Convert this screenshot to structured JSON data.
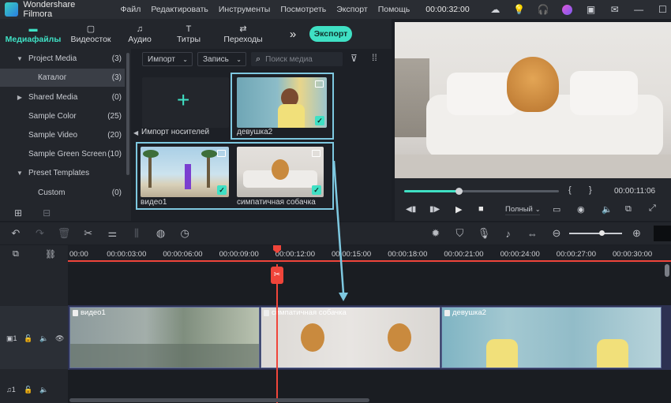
{
  "titlebar": {
    "app_title": "Wondershare Filmora",
    "menus": [
      "Файл",
      "Редактировать",
      "Инструменты",
      "Посмотреть",
      "Экспорт",
      "Помощь"
    ],
    "timecode": "00:00:32:00"
  },
  "media_tabs": {
    "tabs": [
      {
        "label": "Медиафайлы",
        "icon": "folder-icon"
      },
      {
        "label": "Видеосток",
        "icon": "stock-icon"
      },
      {
        "label": "Аудио",
        "icon": "music-note-icon"
      },
      {
        "label": "Титры",
        "icon": "title-t-icon"
      },
      {
        "label": "Переходы",
        "icon": "transition-icon"
      }
    ],
    "export_label": "Экспорт"
  },
  "sidebar": {
    "items": [
      {
        "label": "Project Media",
        "count": "(3)",
        "arrow": "▼"
      },
      {
        "label": "Каталог",
        "count": "(3)",
        "arrow": ""
      },
      {
        "label": "Shared Media",
        "count": "(0)",
        "arrow": "▶"
      },
      {
        "label": "Sample Color",
        "count": "(25)",
        "arrow": ""
      },
      {
        "label": "Sample Video",
        "count": "(20)",
        "arrow": ""
      },
      {
        "label": "Sample Green Screen",
        "count": "(10)",
        "arrow": ""
      },
      {
        "label": "Preset Templates",
        "count": "",
        "arrow": "▼"
      },
      {
        "label": "Custom",
        "count": "(0)",
        "arrow": ""
      }
    ]
  },
  "media_panel": {
    "import_dropdown": "Импорт",
    "record_dropdown": "Запись",
    "search_placeholder": "Поиск медиа",
    "import_label": "Импорт носителей",
    "items": [
      {
        "label": "девушка2"
      },
      {
        "label": "видео1"
      },
      {
        "label": "симпатичная собачка"
      }
    ]
  },
  "preview": {
    "timecode": "00:00:11:06",
    "quality": "Полный",
    "mark_in": "{",
    "mark_out": "}",
    "progress": 0.35
  },
  "timeline": {
    "ruler_labels": [
      "00:00",
      "00:00:03:00",
      "00:00:06:00",
      "00:00:09:00",
      "00:00:12:00",
      "00:00:15:00",
      "00:00:18:00",
      "00:00:21:00",
      "00:00:24:00",
      "00:00:27:00",
      "00:00:30:00"
    ],
    "clips": [
      {
        "label": "видео1"
      },
      {
        "label": "симпатичная собачка"
      },
      {
        "label": "девушка2"
      }
    ],
    "video_track_num": "1",
    "audio_track_num": "1"
  },
  "colors": {
    "accent": "#3fe0c4",
    "playhead": "#f0453a",
    "highlight": "#7ec8e0"
  }
}
